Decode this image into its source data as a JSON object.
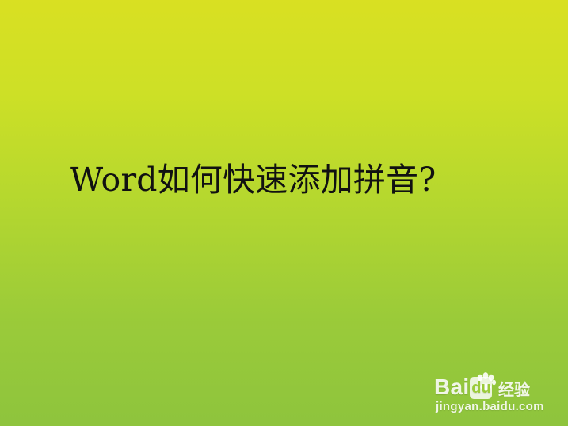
{
  "slide": {
    "title": "Word如何快速添加拼音?"
  },
  "watermark": {
    "brand_prefix": "Bai",
    "brand_badge": "du",
    "brand_suffix": "经验",
    "url": "jingyan.baidu.com",
    "icon": "paw-icon"
  },
  "colors": {
    "background_top": "#d9e022",
    "background_bottom": "#8ec43d",
    "title_text": "#111111",
    "watermark_text": "#ffffff"
  }
}
